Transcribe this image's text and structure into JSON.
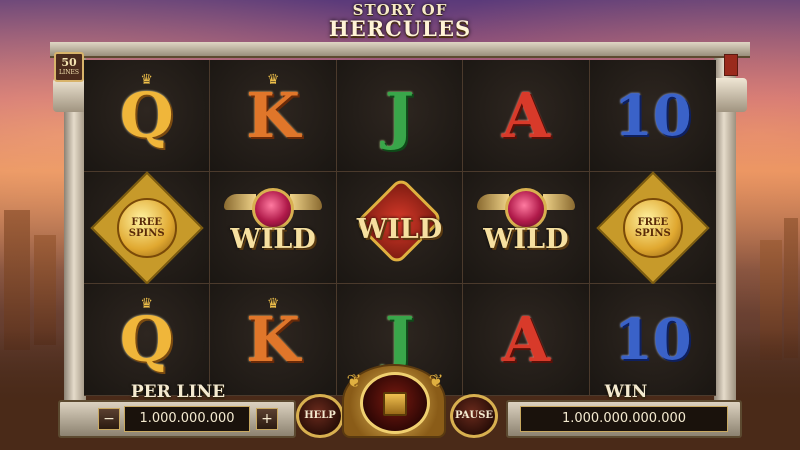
{
  "game": {
    "title_line1": "STORY OF",
    "title_line2": "HERCULES",
    "lines_count": "50",
    "lines_label": "LINES"
  },
  "reels": [
    [
      "Q",
      "K",
      "J",
      "A",
      "10"
    ],
    [
      "FREE SPINS",
      "WILD",
      "WILD",
      "WILD",
      "FREE SPINS"
    ],
    [
      "Q",
      "K",
      "J",
      "A",
      "10"
    ]
  ],
  "symbols": {
    "wild_label": "WILD",
    "free_spins_line1": "FREE",
    "free_spins_line2": "SPINS"
  },
  "controls": {
    "per_line_label": "PER LINE",
    "bet_value": "1.000.000.000",
    "minus_label": "−",
    "plus_label": "+",
    "help_label": "HELP",
    "pause_label": "PAUSE",
    "win_label": "WIN",
    "win_value": "1.000.000.000.000"
  },
  "colors": {
    "gold": "#d8b050",
    "reel_bg": "#1a1612",
    "sky_top": "#5a3a7a",
    "sky_sunset": "#e08a5c"
  }
}
